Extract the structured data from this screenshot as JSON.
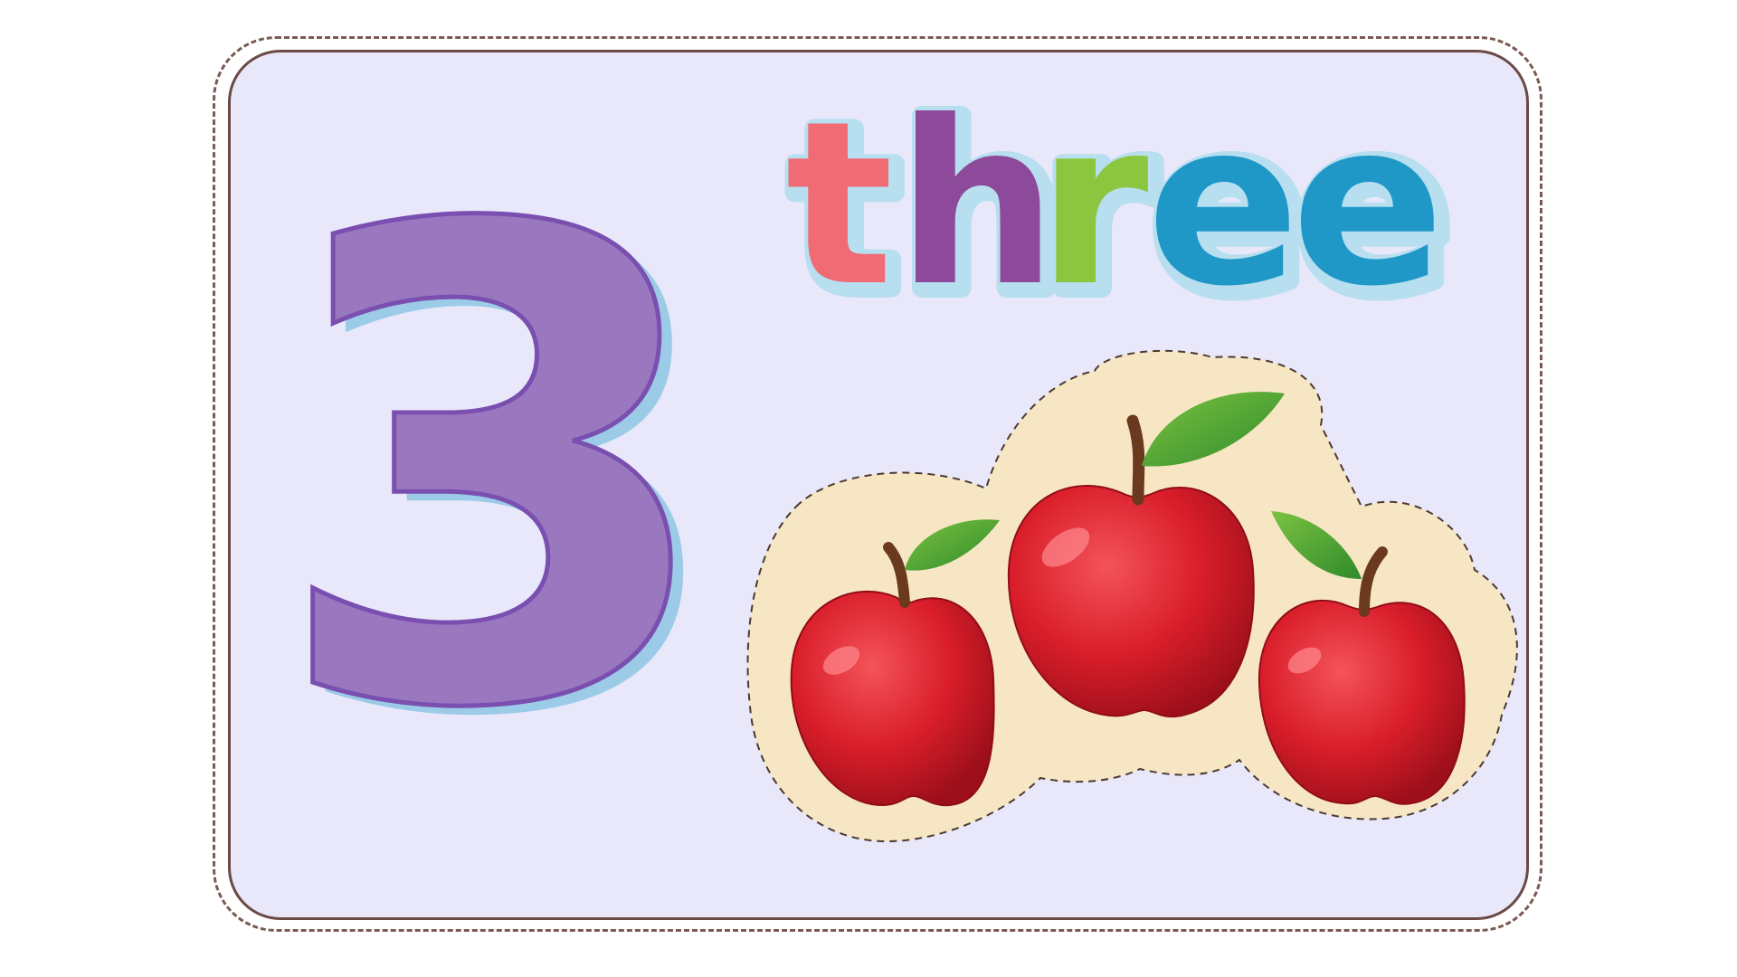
{
  "card": {
    "numeral": "3",
    "word_letters": [
      "t",
      "h",
      "r",
      "e",
      "e"
    ],
    "letter_colors": [
      "#f06b74",
      "#8e4a9a",
      "#8cc63e",
      "#1f98c8",
      "#1f98c8"
    ],
    "numeral_color": "#9a78c0",
    "apple_count": 3
  }
}
